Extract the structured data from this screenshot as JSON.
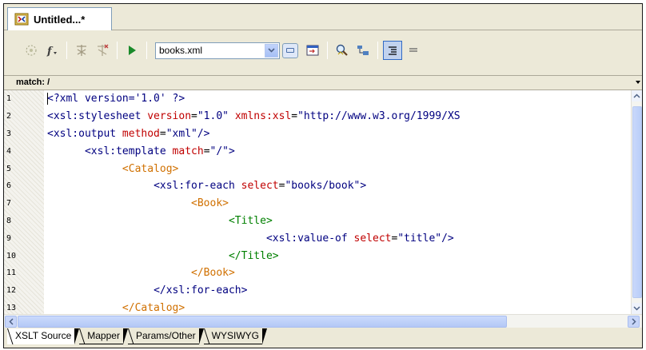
{
  "document_tab": {
    "label": "Untitled...*"
  },
  "toolbar": {
    "source_file": "books.xml",
    "buttons": [
      "debug-settings-icon",
      "function-icon",
      "breakpoint-icon",
      "clear-breakpoint-icon",
      "run-icon",
      "browse-icon",
      "output-window-icon",
      "search-icon",
      "xpath-icon",
      "indent-icon",
      "align-icon"
    ]
  },
  "match_bar": {
    "label": "match: /"
  },
  "editor": {
    "lines": [
      {
        "num": "1",
        "indent": "",
        "tokens": [
          [
            "b",
            "<?xml version='1.0' ?>"
          ]
        ]
      },
      {
        "num": "2",
        "indent": "",
        "tokens": [
          [
            "b",
            "<xsl:stylesheet "
          ],
          [
            "r",
            "version"
          ],
          [
            "k",
            "="
          ],
          [
            "b",
            "\"1.0\" "
          ],
          [
            "r",
            "xmlns:xsl"
          ],
          [
            "k",
            "="
          ],
          [
            "b",
            "\"http://www.w3.org/1999/XS"
          ]
        ]
      },
      {
        "num": "3",
        "indent": "",
        "tokens": [
          [
            "b",
            "<xsl:output "
          ],
          [
            "r",
            "method"
          ],
          [
            "k",
            "="
          ],
          [
            "b",
            "\"xml\"/>"
          ]
        ]
      },
      {
        "num": "4",
        "indent": "      ",
        "tokens": [
          [
            "b",
            "<xsl:template "
          ],
          [
            "r",
            "match"
          ],
          [
            "k",
            "="
          ],
          [
            "b",
            "\"/\">"
          ]
        ]
      },
      {
        "num": "5",
        "indent": "            ",
        "tokens": [
          [
            "o",
            "<Catalog>"
          ]
        ]
      },
      {
        "num": "6",
        "indent": "                 ",
        "tokens": [
          [
            "b",
            "<xsl:for-each "
          ],
          [
            "r",
            "select"
          ],
          [
            "k",
            "="
          ],
          [
            "b",
            "\"books/book\">"
          ]
        ]
      },
      {
        "num": "7",
        "indent": "                       ",
        "tokens": [
          [
            "o",
            "<Book>"
          ]
        ]
      },
      {
        "num": "8",
        "indent": "                             ",
        "tokens": [
          [
            "g",
            "<Title>"
          ]
        ]
      },
      {
        "num": "9",
        "indent": "                                   ",
        "tokens": [
          [
            "b",
            "<xsl:value-of "
          ],
          [
            "r",
            "select"
          ],
          [
            "k",
            "="
          ],
          [
            "b",
            "\"title\"/>"
          ]
        ]
      },
      {
        "num": "10",
        "indent": "                             ",
        "tokens": [
          [
            "g",
            "</Title>"
          ]
        ]
      },
      {
        "num": "11",
        "indent": "                       ",
        "tokens": [
          [
            "o",
            "</Book>"
          ]
        ]
      },
      {
        "num": "12",
        "indent": "                 ",
        "tokens": [
          [
            "b",
            "</xsl:for-each>"
          ]
        ]
      },
      {
        "num": "13",
        "indent": "            ",
        "tokens": [
          [
            "o",
            "</Catalog>"
          ]
        ]
      }
    ]
  },
  "bottom_tabs": [
    {
      "label": "XSLT Source",
      "active": true
    },
    {
      "label": "Mapper",
      "active": false
    },
    {
      "label": "Params/Other",
      "active": false
    },
    {
      "label": "WYSIWYG",
      "active": false
    }
  ]
}
